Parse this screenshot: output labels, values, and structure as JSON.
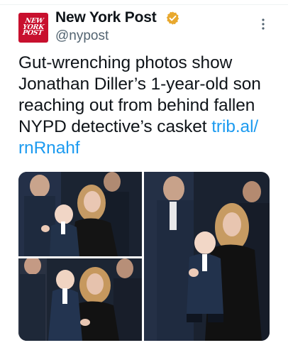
{
  "author": {
    "display_name": "New York Post",
    "handle": "@nypost",
    "avatar_text": "NEW YORK POST",
    "verified_badge_color": "#e8a82e"
  },
  "tweet": {
    "text_plain": "Gut-wrenching photos show\nJonathan Diller’s 1-year-old son\nreaching out from behind fallen\nNYPD detective’s casket ",
    "link_text": "trib.al/\nrnRnahf",
    "link_color": "#1d9bf0"
  },
  "media": {
    "photos": [
      {
        "description_icon": "photo-icon"
      },
      {
        "description_icon": "photo-icon"
      },
      {
        "description_icon": "photo-icon"
      }
    ]
  },
  "icons": {
    "more": "more-options-icon",
    "verified": "verified-badge-icon"
  }
}
